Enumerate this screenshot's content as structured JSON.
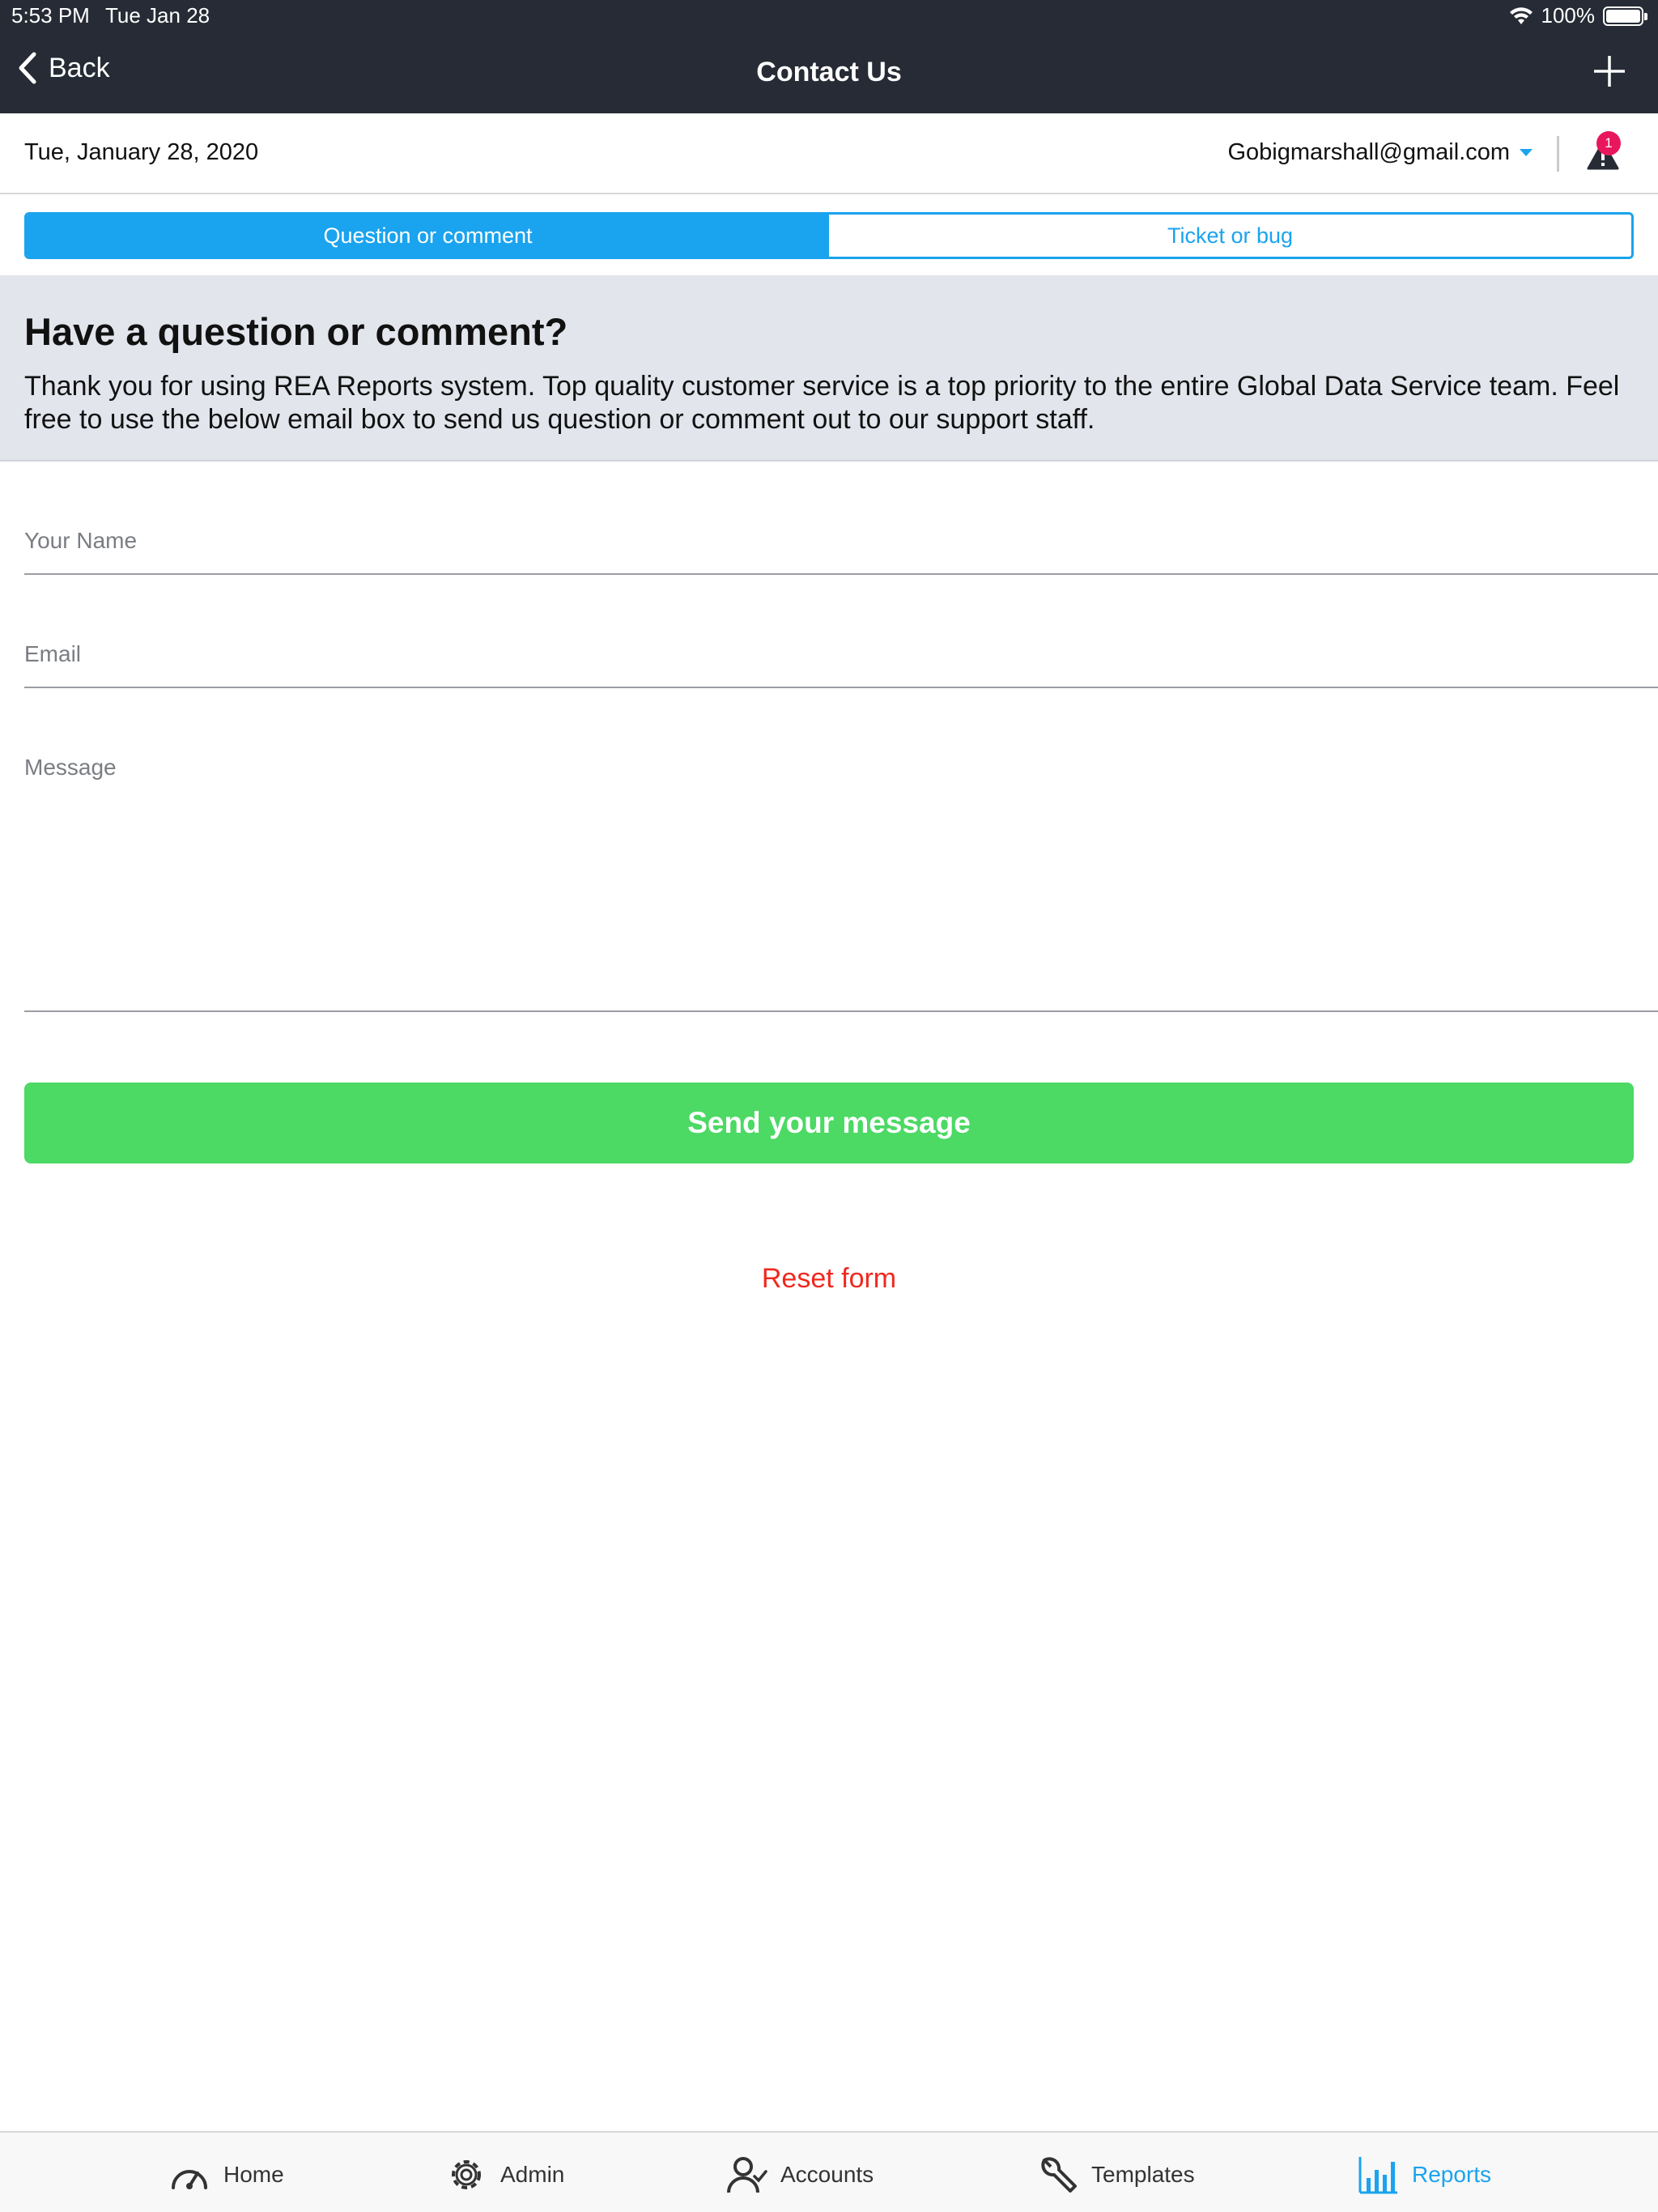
{
  "status_bar": {
    "time": "5:53 PM",
    "date": "Tue Jan 28",
    "battery": "100%"
  },
  "nav": {
    "back_label": "Back",
    "title": "Contact Us"
  },
  "info": {
    "date": "Tue, January 28, 2020",
    "account_email": "Gobigmarshall@gmail.com",
    "alert_count": "1"
  },
  "segments": {
    "question_label": "Question or comment",
    "ticket_label": "Ticket or bug"
  },
  "intro": {
    "heading": "Have a question or comment?",
    "body": "Thank you for using REA Reports system. Top quality customer service is a top priority to the entire Global Data Service team. Feel free to use the below email box to send us question or comment out to our support staff."
  },
  "form": {
    "name_placeholder": "Your Name",
    "email_placeholder": "Email",
    "message_placeholder": "Message",
    "send_label": "Send your message",
    "reset_label": "Reset form"
  },
  "tabs": {
    "home": "Home",
    "admin": "Admin",
    "accounts": "Accounts",
    "templates": "Templates",
    "reports": "Reports"
  },
  "colors": {
    "accent": "#1aa3ee",
    "send": "#4cd964",
    "reset": "#f0281e",
    "header": "#262b35",
    "badge": "#e8175d"
  }
}
